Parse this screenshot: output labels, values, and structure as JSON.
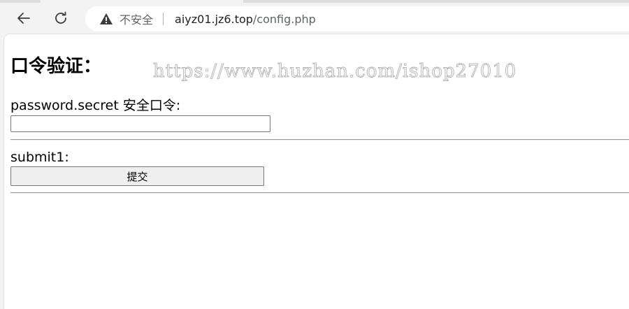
{
  "browser": {
    "security_label": "不安全",
    "url_host": "aiyz01.jz6.top",
    "url_path": "/config.php"
  },
  "page": {
    "title": "口令验证：",
    "watermark": "https://www.huzhan.com/ishop27010",
    "password_label": "password.secret 安全口令:",
    "password_value": "",
    "submit_label": "submit1:",
    "submit_button": "提交"
  }
}
